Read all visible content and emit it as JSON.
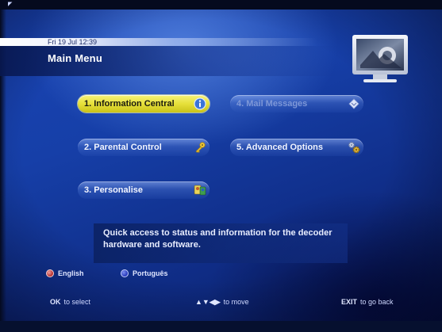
{
  "header": {
    "datetime": "Fri 19 Jul 12:39",
    "title": "Main Menu"
  },
  "menu": {
    "item1": {
      "label": "1.  Information Central",
      "icon": "info-icon",
      "state": "selected"
    },
    "item2": {
      "label": "2.  Parental Control",
      "icon": "key-icon",
      "state": "normal"
    },
    "item3": {
      "label": "3.  Personalise",
      "icon": "personalise-icon",
      "state": "normal"
    },
    "item4": {
      "label": "4.  Mail Messages",
      "icon": "mail-icon",
      "state": "disabled"
    },
    "item5": {
      "label": "5.  Advanced Options",
      "icon": "gears-icon",
      "state": "normal"
    }
  },
  "description": {
    "line1": "Quick access to status and information for the decoder",
    "line2": "hardware and software."
  },
  "languages": {
    "red": "English",
    "blue": "Português"
  },
  "footer": {
    "ok_key": "OK",
    "ok_action": "to select",
    "move_key": "▲▼◀▶",
    "move_action": "to move",
    "exit_key": "EXIT",
    "exit_action": "to go back"
  },
  "colors": {
    "background": "#163fa8",
    "selected_button": "#e6e03a",
    "red_key": "#b22a2a",
    "blue_key": "#2134b8"
  }
}
